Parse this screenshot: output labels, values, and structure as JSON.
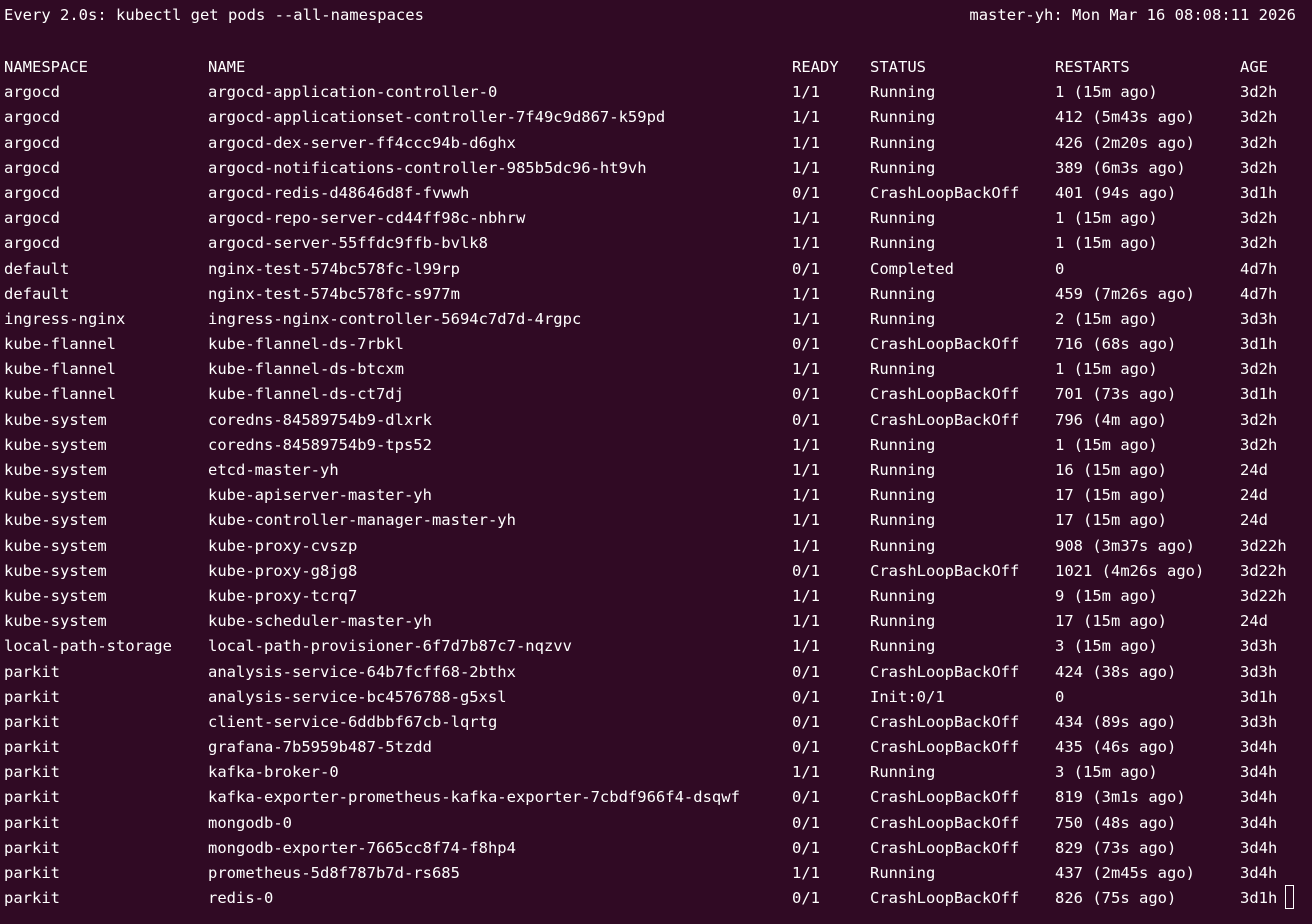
{
  "header": {
    "command": "Every 2.0s: kubectl get pods --all-namespaces",
    "host_time": "master-yh: Mon Mar 16 08:08:11 2026"
  },
  "columns": {
    "namespace": "NAMESPACE",
    "name": "NAME",
    "ready": "READY",
    "status": "STATUS",
    "restarts": "RESTARTS",
    "age": "AGE"
  },
  "rows": [
    {
      "namespace": "argocd",
      "name": "argocd-application-controller-0",
      "ready": "1/1",
      "status": "Running",
      "restarts": "1 (15m ago)",
      "age": "3d2h"
    },
    {
      "namespace": "argocd",
      "name": "argocd-applicationset-controller-7f49c9d867-k59pd",
      "ready": "1/1",
      "status": "Running",
      "restarts": "412 (5m43s ago)",
      "age": "3d2h"
    },
    {
      "namespace": "argocd",
      "name": "argocd-dex-server-ff4ccc94b-d6ghx",
      "ready": "1/1",
      "status": "Running",
      "restarts": "426 (2m20s ago)",
      "age": "3d2h"
    },
    {
      "namespace": "argocd",
      "name": "argocd-notifications-controller-985b5dc96-ht9vh",
      "ready": "1/1",
      "status": "Running",
      "restarts": "389 (6m3s ago)",
      "age": "3d2h"
    },
    {
      "namespace": "argocd",
      "name": "argocd-redis-d48646d8f-fvwwh",
      "ready": "0/1",
      "status": "CrashLoopBackOff",
      "restarts": "401 (94s ago)",
      "age": "3d1h"
    },
    {
      "namespace": "argocd",
      "name": "argocd-repo-server-cd44ff98c-nbhrw",
      "ready": "1/1",
      "status": "Running",
      "restarts": "1 (15m ago)",
      "age": "3d2h"
    },
    {
      "namespace": "argocd",
      "name": "argocd-server-55ffdc9ffb-bvlk8",
      "ready": "1/1",
      "status": "Running",
      "restarts": "1 (15m ago)",
      "age": "3d2h"
    },
    {
      "namespace": "default",
      "name": "nginx-test-574bc578fc-l99rp",
      "ready": "0/1",
      "status": "Completed",
      "restarts": "0",
      "age": "4d7h"
    },
    {
      "namespace": "default",
      "name": "nginx-test-574bc578fc-s977m",
      "ready": "1/1",
      "status": "Running",
      "restarts": "459 (7m26s ago)",
      "age": "4d7h"
    },
    {
      "namespace": "ingress-nginx",
      "name": "ingress-nginx-controller-5694c7d7d-4rgpc",
      "ready": "1/1",
      "status": "Running",
      "restarts": "2 (15m ago)",
      "age": "3d3h"
    },
    {
      "namespace": "kube-flannel",
      "name": "kube-flannel-ds-7rbkl",
      "ready": "0/1",
      "status": "CrashLoopBackOff",
      "restarts": "716 (68s ago)",
      "age": "3d1h"
    },
    {
      "namespace": "kube-flannel",
      "name": "kube-flannel-ds-btcxm",
      "ready": "1/1",
      "status": "Running",
      "restarts": "1 (15m ago)",
      "age": "3d2h"
    },
    {
      "namespace": "kube-flannel",
      "name": "kube-flannel-ds-ct7dj",
      "ready": "0/1",
      "status": "CrashLoopBackOff",
      "restarts": "701 (73s ago)",
      "age": "3d1h"
    },
    {
      "namespace": "kube-system",
      "name": "coredns-84589754b9-dlxrk",
      "ready": "0/1",
      "status": "CrashLoopBackOff",
      "restarts": "796 (4m ago)",
      "age": "3d2h"
    },
    {
      "namespace": "kube-system",
      "name": "coredns-84589754b9-tps52",
      "ready": "1/1",
      "status": "Running",
      "restarts": "1 (15m ago)",
      "age": "3d2h"
    },
    {
      "namespace": "kube-system",
      "name": "etcd-master-yh",
      "ready": "1/1",
      "status": "Running",
      "restarts": "16 (15m ago)",
      "age": "24d"
    },
    {
      "namespace": "kube-system",
      "name": "kube-apiserver-master-yh",
      "ready": "1/1",
      "status": "Running",
      "restarts": "17 (15m ago)",
      "age": "24d"
    },
    {
      "namespace": "kube-system",
      "name": "kube-controller-manager-master-yh",
      "ready": "1/1",
      "status": "Running",
      "restarts": "17 (15m ago)",
      "age": "24d"
    },
    {
      "namespace": "kube-system",
      "name": "kube-proxy-cvszp",
      "ready": "1/1",
      "status": "Running",
      "restarts": "908 (3m37s ago)",
      "age": "3d22h"
    },
    {
      "namespace": "kube-system",
      "name": "kube-proxy-g8jg8",
      "ready": "0/1",
      "status": "CrashLoopBackOff",
      "restarts": "1021 (4m26s ago)",
      "age": "3d22h"
    },
    {
      "namespace": "kube-system",
      "name": "kube-proxy-tcrq7",
      "ready": "1/1",
      "status": "Running",
      "restarts": "9 (15m ago)",
      "age": "3d22h"
    },
    {
      "namespace": "kube-system",
      "name": "kube-scheduler-master-yh",
      "ready": "1/1",
      "status": "Running",
      "restarts": "17 (15m ago)",
      "age": "24d"
    },
    {
      "namespace": "local-path-storage",
      "name": "local-path-provisioner-6f7d7b87c7-nqzvv",
      "ready": "1/1",
      "status": "Running",
      "restarts": "3 (15m ago)",
      "age": "3d3h"
    },
    {
      "namespace": "parkit",
      "name": "analysis-service-64b7fcff68-2bthx",
      "ready": "0/1",
      "status": "CrashLoopBackOff",
      "restarts": "424 (38s ago)",
      "age": "3d3h"
    },
    {
      "namespace": "parkit",
      "name": "analysis-service-bc4576788-g5xsl",
      "ready": "0/1",
      "status": "Init:0/1",
      "restarts": "0",
      "age": "3d1h"
    },
    {
      "namespace": "parkit",
      "name": "client-service-6ddbbf67cb-lqrtg",
      "ready": "0/1",
      "status": "CrashLoopBackOff",
      "restarts": "434 (89s ago)",
      "age": "3d3h"
    },
    {
      "namespace": "parkit",
      "name": "grafana-7b5959b487-5tzdd",
      "ready": "0/1",
      "status": "CrashLoopBackOff",
      "restarts": "435 (46s ago)",
      "age": "3d4h"
    },
    {
      "namespace": "parkit",
      "name": "kafka-broker-0",
      "ready": "1/1",
      "status": "Running",
      "restarts": "3 (15m ago)",
      "age": "3d4h"
    },
    {
      "namespace": "parkit",
      "name": "kafka-exporter-prometheus-kafka-exporter-7cbdf966f4-dsqwf",
      "ready": "0/1",
      "status": "CrashLoopBackOff",
      "restarts": "819 (3m1s ago)",
      "age": "3d4h"
    },
    {
      "namespace": "parkit",
      "name": "mongodb-0",
      "ready": "0/1",
      "status": "CrashLoopBackOff",
      "restarts": "750 (48s ago)",
      "age": "3d4h"
    },
    {
      "namespace": "parkit",
      "name": "mongodb-exporter-7665cc8f74-f8hp4",
      "ready": "0/1",
      "status": "CrashLoopBackOff",
      "restarts": "829 (73s ago)",
      "age": "3d4h"
    },
    {
      "namespace": "parkit",
      "name": "prometheus-5d8f787b7d-rs685",
      "ready": "1/1",
      "status": "Running",
      "restarts": "437 (2m45s ago)",
      "age": "3d4h"
    },
    {
      "namespace": "parkit",
      "name": "redis-0",
      "ready": "0/1",
      "status": "CrashLoopBackOff",
      "restarts": "826 (75s ago)",
      "age": "3d1h"
    }
  ]
}
